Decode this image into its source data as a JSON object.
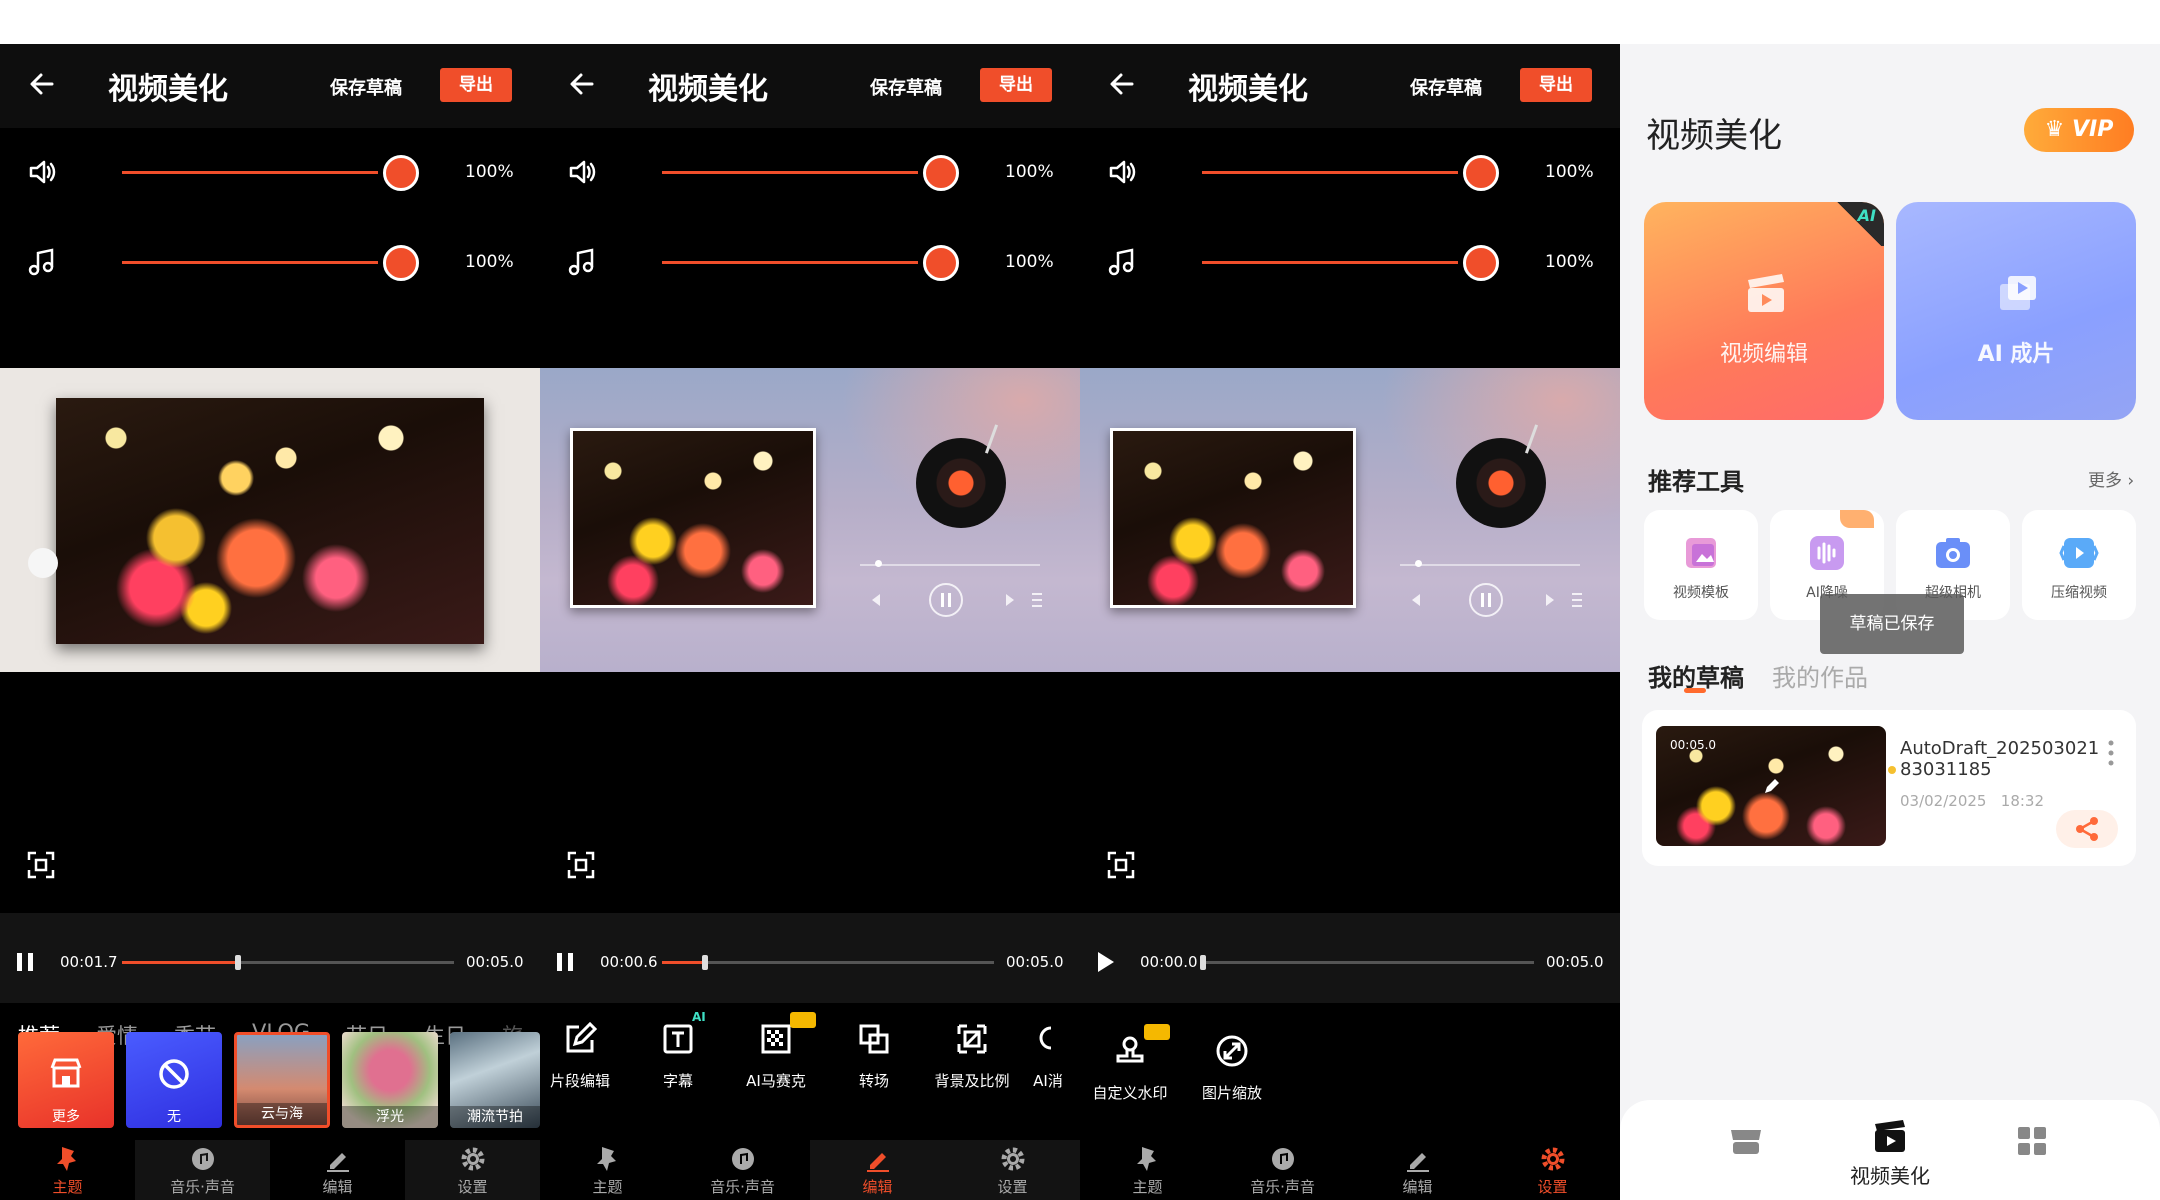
{
  "editor": {
    "title": "视频美化",
    "save_draft": "保存草稿",
    "export": "导出",
    "volume_original_pct": "100%",
    "volume_music_pct": "100%",
    "total_time": "00:05.0"
  },
  "panels": [
    {
      "current_time": "00:01.7",
      "progress": 0.345,
      "playing": true,
      "active_nav": "主题"
    },
    {
      "current_time": "00:00.6",
      "progress": 0.125,
      "playing": true,
      "active_nav": "编辑"
    },
    {
      "current_time": "00:00.0",
      "progress": 0.0,
      "playing": false,
      "active_nav": "设置"
    }
  ],
  "categories": [
    "推荐",
    "爱情",
    "季节",
    "VLOG",
    "节日",
    "生日",
    "旅行"
  ],
  "themes": [
    "更多",
    "无",
    "云与海",
    "浮光",
    "潮流节拍"
  ],
  "edit_tools": [
    {
      "label": "片段编辑",
      "icon": "edit-icon"
    },
    {
      "label": "字幕",
      "icon": "text-icon",
      "badge": "AI"
    },
    {
      "label": "AI马赛克",
      "icon": "mosaic-icon",
      "badge": "crown"
    },
    {
      "label": "转场",
      "icon": "transition-icon"
    },
    {
      "label": "背景及比例",
      "icon": "crop-icon"
    },
    {
      "label": "AI消",
      "icon": "ai-eraser-icon"
    }
  ],
  "settings_tools": [
    {
      "label": "自定义水印",
      "icon": "watermark-icon",
      "badge": "crown"
    },
    {
      "label": "图片缩放",
      "icon": "zoom-icon"
    }
  ],
  "nav": [
    "主题",
    "音乐·声音",
    "编辑",
    "设置"
  ],
  "home": {
    "title": "视频美化",
    "vip": "VIP",
    "card_edit": "视频编辑",
    "card_ai": "AI 成片",
    "ai_corner": "AI",
    "section_tools": "推荐工具",
    "more": "更多",
    "tools": [
      "视频模板",
      "AI降噪",
      "超级相机",
      "压缩视频"
    ],
    "toast": "草稿已保存",
    "tab_drafts": "我的草稿",
    "tab_works": "我的作品",
    "draft": {
      "duration": "00:05.0",
      "name": "AutoDraft_20250302183031185",
      "date": "03/02/2025",
      "time": "18:32"
    },
    "bottom_nav_label": "视频美化"
  },
  "colors": {
    "accent": "#f04e2a",
    "vip_orange": "#ff8a2a",
    "card_purple": "#8da2ff"
  }
}
